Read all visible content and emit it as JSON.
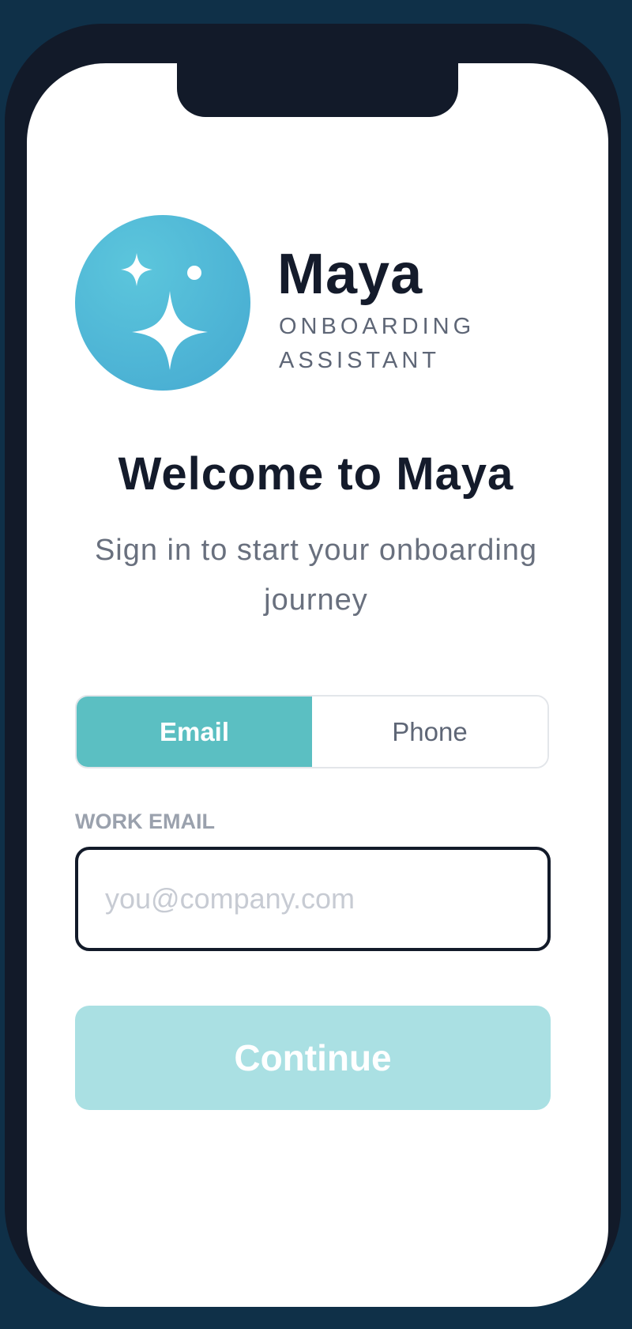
{
  "brand": {
    "name": "Maya",
    "subtitle": "ONBOARDING ASSISTANT",
    "logo_icon": "sparkles-icon"
  },
  "welcome": {
    "title": "Welcome to Maya",
    "subtitle": "Sign in to start your onboarding journey"
  },
  "method_toggle": {
    "options": [
      "Email",
      "Phone"
    ],
    "selected": "Email"
  },
  "email_field": {
    "label": "WORK EMAIL",
    "value": "",
    "placeholder": "you@company.com"
  },
  "continue_button": {
    "label": "Continue",
    "enabled": false
  },
  "colors": {
    "background": "#0f3048",
    "frame": "#121a29",
    "accent": "#5bbfc2",
    "accent_disabled": "#aae0e3",
    "logo": "#4fb6d6",
    "text_primary": "#141b2b",
    "text_secondary": "#69707e"
  }
}
